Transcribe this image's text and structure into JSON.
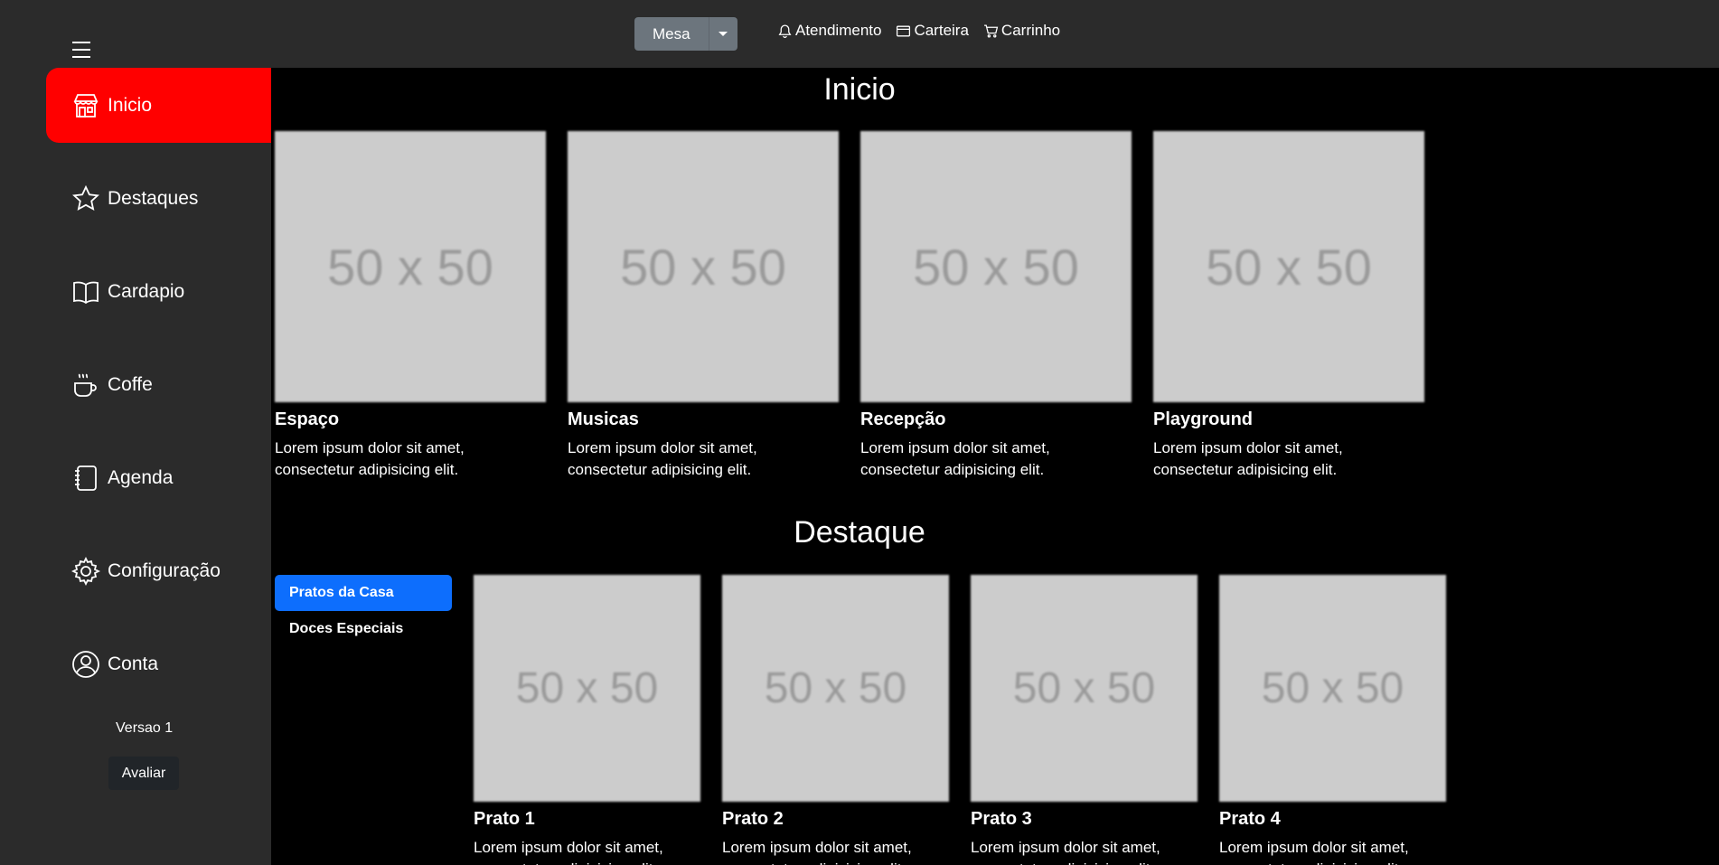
{
  "header": {
    "mesa_label": "Mesa",
    "nav": [
      {
        "label": "Atendimento",
        "icon": "bell-icon"
      },
      {
        "label": "Carteira",
        "icon": "wallet-icon"
      },
      {
        "label": "Carrinho",
        "icon": "cart-icon"
      }
    ]
  },
  "sidebar": {
    "items": [
      {
        "label": "Inicio",
        "icon": "store-icon",
        "active": true
      },
      {
        "label": "Destaques",
        "icon": "star-icon"
      },
      {
        "label": "Cardapio",
        "icon": "book-icon"
      },
      {
        "label": "Coffe",
        "icon": "cup-icon"
      },
      {
        "label": "Agenda",
        "icon": "journal-icon"
      },
      {
        "label": "Configuração",
        "icon": "gear-icon"
      },
      {
        "label": "Conta",
        "icon": "person-circle-icon"
      }
    ],
    "version": "Versao 1",
    "rate_label": "Avaliar"
  },
  "inicio": {
    "title": "Inicio",
    "cards": [
      {
        "image": "50 x 50",
        "title": "Espaço",
        "text": "Lorem ipsum dolor sit amet, consectetur adipisicing elit."
      },
      {
        "image": "50 x 50",
        "title": "Musicas",
        "text": "Lorem ipsum dolor sit amet, consectetur adipisicing elit."
      },
      {
        "image": "50 x 50",
        "title": "Recepção",
        "text": "Lorem ipsum dolor sit amet, consectetur adipisicing elit."
      },
      {
        "image": "50 x 50",
        "title": "Playground",
        "text": "Lorem ipsum dolor sit amet, consectetur adipisicing elit."
      }
    ]
  },
  "destaque": {
    "title": "Destaque",
    "tabs": [
      {
        "label": "Pratos da Casa",
        "active": true
      },
      {
        "label": "Doces Especiais"
      }
    ],
    "cards": [
      {
        "image": "50 x 50",
        "title": "Prato 1",
        "text": "Lorem ipsum dolor sit amet, consectetur adipisicing elit."
      },
      {
        "image": "50 x 50",
        "title": "Prato 2",
        "text": "Lorem ipsum dolor sit amet, consectetur adipisicing elit."
      },
      {
        "image": "50 x 50",
        "title": "Prato 3",
        "text": "Lorem ipsum dolor sit amet, consectetur adipisicing elit."
      },
      {
        "image": "50 x 50",
        "title": "Prato 4",
        "text": "Lorem ipsum dolor sit amet, consectetur adipisicing elit."
      }
    ]
  },
  "colors": {
    "sidebar_bg": "#2b2b2b",
    "active_red": "#ff0000",
    "tab_blue": "#0d6efd",
    "placeholder_gray": "#cccccc"
  }
}
